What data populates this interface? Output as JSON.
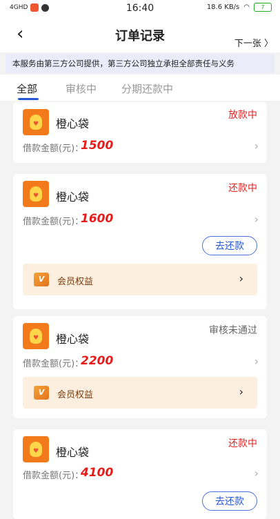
{
  "statusbar": {
    "time": "16:40",
    "signal": "4GHD",
    "net_speed": "18.6 KB/s",
    "battery": "7"
  },
  "header": {
    "title": "订单记录",
    "next_label": "下一张 〉"
  },
  "notice": "本服务由第三方公司提供，第三方公司独立承担全部责任与义务",
  "tabs": [
    "全部",
    "审核中",
    "分期还款中"
  ],
  "orders": [
    {
      "name": "橙心袋",
      "status": "放款中",
      "amount_label": "借款金额(元)：",
      "amount": "1500"
    },
    {
      "name": "橙心袋",
      "status": "还款中",
      "amount_label": "借款金额(元)：",
      "amount": "1600",
      "action": "去还款",
      "member": "会员权益"
    },
    {
      "name": "橙心袋",
      "status": "审核未通过",
      "amount_label": "借款金额(元)：",
      "amount": "2200",
      "member": "会员权益"
    },
    {
      "name": "橙心袋",
      "status": "还款中",
      "amount_label": "借款金额(元)：",
      "amount": "4100",
      "action": "去还款"
    }
  ],
  "colors": {
    "accent": "#2457d6",
    "status_red": "#e52222",
    "product_orange": "#f27a1a",
    "member_bg": "#fcefdf"
  },
  "icons": [
    "back-arrow-icon",
    "chevron-right-icon",
    "vip-icon",
    "money-bag-icon"
  ]
}
